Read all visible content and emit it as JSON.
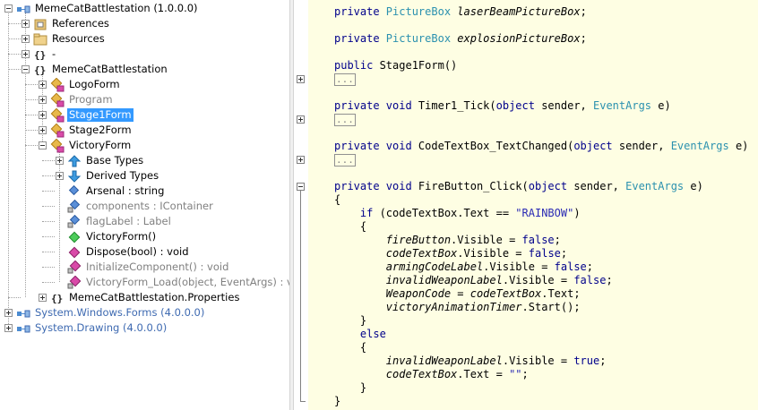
{
  "tree": {
    "items": [
      {
        "label": "MemeCatBattlestation (1.0.0.0)",
        "icon": "assembly-icon",
        "expander": "minus",
        "style": "normal"
      },
      {
        "label": "References",
        "icon": "references-folder-icon",
        "expander": "plus",
        "style": "normal"
      },
      {
        "label": "Resources",
        "icon": "resources-folder-icon",
        "expander": "plus",
        "style": "normal"
      },
      {
        "label": "-",
        "icon": "namespace-icon",
        "expander": "plus",
        "style": "normal"
      },
      {
        "label": "MemeCatBattlestation",
        "icon": "namespace-icon",
        "expander": "minus",
        "style": "normal"
      },
      {
        "label": "LogoForm",
        "icon": "class-icon",
        "expander": "plus",
        "style": "normal"
      },
      {
        "label": "Program",
        "icon": "class-icon",
        "expander": "plus",
        "style": "gray"
      },
      {
        "label": "Stage1Form",
        "icon": "class-icon",
        "expander": "plus",
        "style": "selected"
      },
      {
        "label": "Stage2Form",
        "icon": "class-icon",
        "expander": "plus",
        "style": "normal"
      },
      {
        "label": "VictoryForm",
        "icon": "class-icon",
        "expander": "minus",
        "style": "normal"
      },
      {
        "label": "Base Types",
        "icon": "base-types-icon",
        "expander": "plus",
        "style": "normal"
      },
      {
        "label": "Derived Types",
        "icon": "derived-types-icon",
        "expander": "plus",
        "style": "normal"
      },
      {
        "label": "Arsenal : string",
        "icon": "property-icon",
        "expander": "none",
        "style": "normal"
      },
      {
        "label": "components : IContainer",
        "icon": "private-field-icon",
        "expander": "none",
        "style": "gray"
      },
      {
        "label": "flagLabel : Label",
        "icon": "private-field-icon",
        "expander": "none",
        "style": "gray"
      },
      {
        "label": "VictoryForm()",
        "icon": "constructor-icon",
        "expander": "none",
        "style": "normal"
      },
      {
        "label": "Dispose(bool) : void",
        "icon": "method-icon",
        "expander": "none",
        "style": "normal"
      },
      {
        "label": "InitializeComponent() : void",
        "icon": "private-method-icon",
        "expander": "none",
        "style": "gray"
      },
      {
        "label": "VictoryForm_Load(object, EventArgs) : voi",
        "icon": "private-method-icon",
        "expander": "none",
        "style": "gray"
      },
      {
        "label": "MemeCatBattlestation.Properties",
        "icon": "namespace-icon",
        "expander": "plus",
        "style": "normal"
      },
      {
        "label": "System.Windows.Forms (4.0.0.0)",
        "icon": "assembly-icon",
        "expander": "plus",
        "style": "blue"
      },
      {
        "label": "System.Drawing (4.0.0.0)",
        "icon": "assembly-icon",
        "expander": "plus",
        "style": "blue"
      }
    ]
  },
  "code": {
    "lines": [
      [
        {
          "t": "private ",
          "c": "kw"
        },
        {
          "t": "PictureBox ",
          "c": "ty"
        },
        {
          "t": "laserBeamPictureBox",
          "c": "it"
        },
        {
          "t": ";",
          "c": ""
        }
      ],
      [],
      [
        {
          "t": "private ",
          "c": "kw"
        },
        {
          "t": "PictureBox ",
          "c": "ty"
        },
        {
          "t": "explosionPictureBox",
          "c": "it"
        },
        {
          "t": ";",
          "c": ""
        }
      ],
      [],
      [
        {
          "t": "public ",
          "c": "kw"
        },
        {
          "t": "Stage1Form()",
          "c": ""
        }
      ],
      [
        {
          "t": "...",
          "c": "fold"
        }
      ],
      [],
      [
        {
          "t": "private ",
          "c": "kw"
        },
        {
          "t": "void ",
          "c": "kw"
        },
        {
          "t": "Timer1_Tick(",
          "c": ""
        },
        {
          "t": "object ",
          "c": "kw"
        },
        {
          "t": "sender, ",
          "c": ""
        },
        {
          "t": "EventArgs ",
          "c": "ty"
        },
        {
          "t": "e)",
          "c": ""
        }
      ],
      [
        {
          "t": "...",
          "c": "fold"
        }
      ],
      [],
      [
        {
          "t": "private ",
          "c": "kw"
        },
        {
          "t": "void ",
          "c": "kw"
        },
        {
          "t": "CodeTextBox_TextChanged(",
          "c": ""
        },
        {
          "t": "object ",
          "c": "kw"
        },
        {
          "t": "sender, ",
          "c": ""
        },
        {
          "t": "EventArgs ",
          "c": "ty"
        },
        {
          "t": "e)",
          "c": ""
        }
      ],
      [
        {
          "t": "...",
          "c": "fold"
        }
      ],
      [],
      [
        {
          "t": "private ",
          "c": "kw"
        },
        {
          "t": "void ",
          "c": "kw"
        },
        {
          "t": "FireButton_Click(",
          "c": ""
        },
        {
          "t": "object ",
          "c": "kw"
        },
        {
          "t": "sender, ",
          "c": ""
        },
        {
          "t": "EventArgs ",
          "c": "ty"
        },
        {
          "t": "e)",
          "c": ""
        }
      ],
      [
        {
          "t": "{",
          "c": ""
        }
      ],
      [
        {
          "t": "    if ",
          "c": "kw"
        },
        {
          "t": "(codeTextBox.Text == ",
          "c": ""
        },
        {
          "t": "\"RAINBOW\"",
          "c": "str"
        },
        {
          "t": ")",
          "c": ""
        }
      ],
      [
        {
          "t": "    {",
          "c": ""
        }
      ],
      [
        {
          "t": "        ",
          "c": ""
        },
        {
          "t": "fireButton",
          "c": "it"
        },
        {
          "t": ".Visible = ",
          "c": ""
        },
        {
          "t": "false",
          "c": "kw"
        },
        {
          "t": ";",
          "c": ""
        }
      ],
      [
        {
          "t": "        ",
          "c": ""
        },
        {
          "t": "codeTextBox",
          "c": "it"
        },
        {
          "t": ".Visible = ",
          "c": ""
        },
        {
          "t": "false",
          "c": "kw"
        },
        {
          "t": ";",
          "c": ""
        }
      ],
      [
        {
          "t": "        ",
          "c": ""
        },
        {
          "t": "armingCodeLabel",
          "c": "it"
        },
        {
          "t": ".Visible = ",
          "c": ""
        },
        {
          "t": "false",
          "c": "kw"
        },
        {
          "t": ";",
          "c": ""
        }
      ],
      [
        {
          "t": "        ",
          "c": ""
        },
        {
          "t": "invalidWeaponLabel",
          "c": "it"
        },
        {
          "t": ".Visible = ",
          "c": ""
        },
        {
          "t": "false",
          "c": "kw"
        },
        {
          "t": ";",
          "c": ""
        }
      ],
      [
        {
          "t": "        ",
          "c": ""
        },
        {
          "t": "WeaponCode",
          "c": "it"
        },
        {
          "t": " = ",
          "c": ""
        },
        {
          "t": "codeTextBox",
          "c": "it"
        },
        {
          "t": ".Text;",
          "c": ""
        }
      ],
      [
        {
          "t": "        ",
          "c": ""
        },
        {
          "t": "victoryAnimationTimer",
          "c": "it"
        },
        {
          "t": ".Start();",
          "c": ""
        }
      ],
      [
        {
          "t": "    }",
          "c": ""
        }
      ],
      [
        {
          "t": "    else",
          "c": "kw"
        }
      ],
      [
        {
          "t": "    {",
          "c": ""
        }
      ],
      [
        {
          "t": "        ",
          "c": ""
        },
        {
          "t": "invalidWeaponLabel",
          "c": "it"
        },
        {
          "t": ".Visible = ",
          "c": ""
        },
        {
          "t": "true",
          "c": "kw"
        },
        {
          "t": ";",
          "c": ""
        }
      ],
      [
        {
          "t": "        ",
          "c": ""
        },
        {
          "t": "codeTextBox",
          "c": "it"
        },
        {
          "t": ".Text = ",
          "c": ""
        },
        {
          "t": "\"\"",
          "c": "str"
        },
        {
          "t": ";",
          "c": ""
        }
      ],
      [
        {
          "t": "    }",
          "c": ""
        }
      ],
      [
        {
          "t": "}",
          "c": ""
        }
      ]
    ]
  }
}
